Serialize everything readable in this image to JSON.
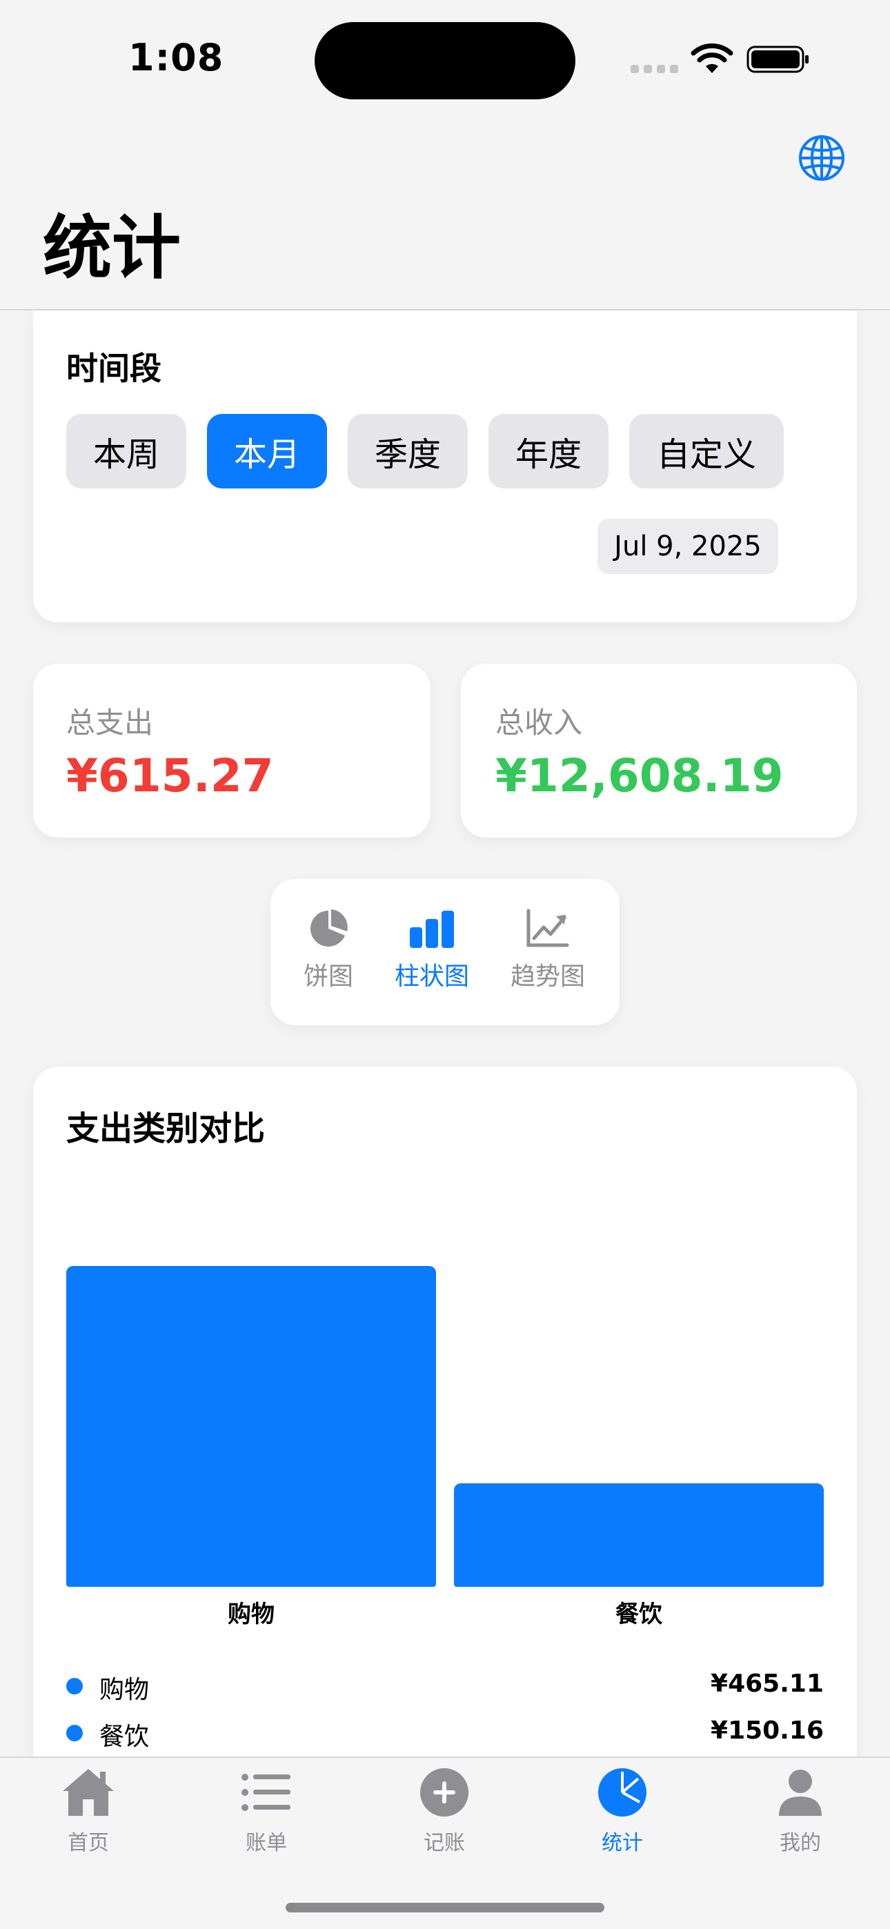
{
  "status_bar": {
    "time": "1:08"
  },
  "header": {
    "title": "统计",
    "globe_icon": "globe-icon"
  },
  "period": {
    "title": "时间段",
    "options": [
      "本周",
      "本月",
      "季度",
      "年度",
      "自定义"
    ],
    "selected": "本月",
    "date": "Jul 9, 2025"
  },
  "summary": {
    "expense_label": "总支出",
    "expense_value": "¥615.27",
    "income_label": "总收入",
    "income_value": "¥12,608.19",
    "colors": {
      "expense": "#f23c35",
      "income": "#34c759"
    }
  },
  "chart_switcher": {
    "items": [
      {
        "label": "饼图",
        "icon": "pie-chart-icon"
      },
      {
        "label": "柱状图",
        "icon": "bar-chart-icon"
      },
      {
        "label": "趋势图",
        "icon": "trend-chart-icon"
      }
    ],
    "selected": "柱状图"
  },
  "chart_card": {
    "title": "支出类别对比"
  },
  "chart_data": {
    "type": "bar",
    "title": "支出类别对比",
    "categories": [
      "购物",
      "餐饮"
    ],
    "values": [
      465.11,
      150.16
    ],
    "ylim": [
      0,
      600
    ],
    "grid": false,
    "color": "#0a7aff"
  },
  "legend": [
    {
      "name": "购物",
      "value": "¥465.11"
    },
    {
      "name": "餐饮",
      "value": "¥150.16"
    }
  ],
  "tabbar": {
    "items": [
      {
        "label": "首页",
        "icon": "house-icon"
      },
      {
        "label": "账单",
        "icon": "list-icon"
      },
      {
        "label": "记账",
        "icon": "plus-circle-icon"
      },
      {
        "label": "统计",
        "icon": "chart-pie-icon"
      },
      {
        "label": "我的",
        "icon": "person-icon"
      }
    ],
    "selected": "统计"
  },
  "accent_color": "#0a7aff"
}
